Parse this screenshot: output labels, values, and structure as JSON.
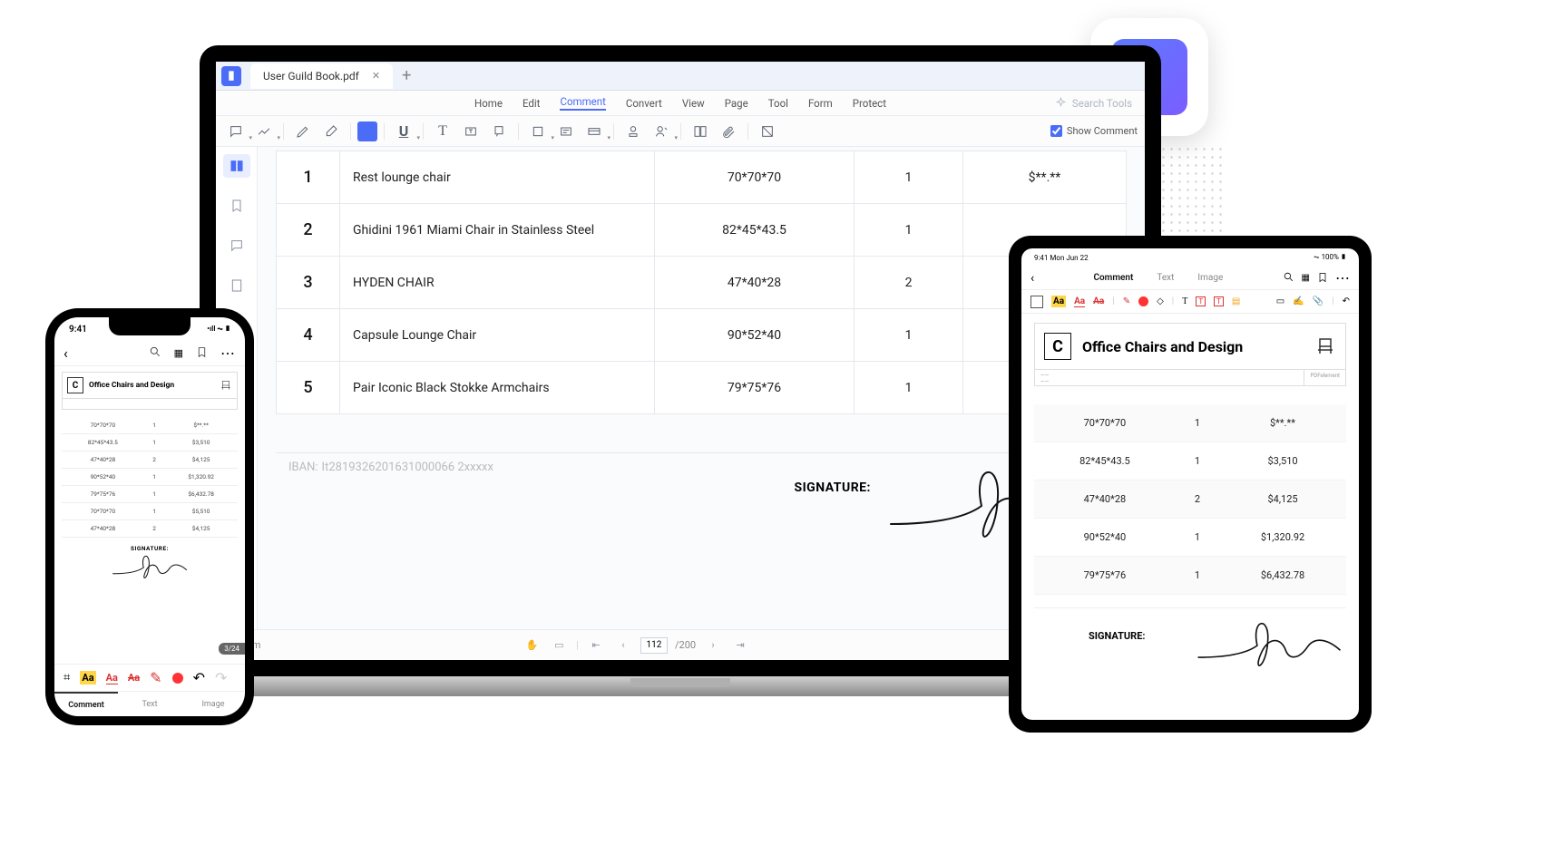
{
  "app_badge": {
    "name": "signature-app"
  },
  "laptop": {
    "tab_title": "User Guild Book.pdf",
    "menus": [
      "Home",
      "Edit",
      "Comment",
      "Convert",
      "View",
      "Page",
      "Tool",
      "Form",
      "Protect"
    ],
    "active_menu": "Comment",
    "search_placeholder": "Search Tools",
    "show_comment_label": "Show Comment",
    "show_comment_checked": true,
    "table_rows": [
      {
        "idx": "1",
        "name": "Rest lounge chair",
        "dims": "70*70*70",
        "qty": "1",
        "price": "$**.**"
      },
      {
        "idx": "2",
        "name": "Ghidini 1961 Miami Chair in Stainless Steel",
        "dims": "82*45*43.5",
        "qty": "1",
        "price": ""
      },
      {
        "idx": "3",
        "name": "HYDEN CHAIR",
        "dims": "47*40*28",
        "qty": "2",
        "price": ""
      },
      {
        "idx": "4",
        "name": "Capsule Lounge Chair",
        "dims": "90*52*40",
        "qty": "1",
        "price": ""
      },
      {
        "idx": "5",
        "name": "Pair Iconic Black Stokke Armchairs",
        "dims": "79*75*76",
        "qty": "1",
        "price": ""
      }
    ],
    "iban_label": "IBAN:",
    "iban_value": "It2819326201631000066 2xxxxx",
    "signature_label": "SIGNATURE:",
    "status": {
      "unit": "cm",
      "page": "112",
      "total": "/200"
    }
  },
  "phone": {
    "status_time": "9:41",
    "doc_title": "Office Chairs and Design",
    "rows": [
      {
        "dims": "70*70*70",
        "qty": "1",
        "price": "$**.**"
      },
      {
        "dims": "82*45*43.5",
        "qty": "1",
        "price": "$3,510"
      },
      {
        "dims": "47*40*28",
        "qty": "2",
        "price": "$4,125"
      },
      {
        "dims": "90*52*40",
        "qty": "1",
        "price": "$1,320.92"
      },
      {
        "dims": "79*75*76",
        "qty": "1",
        "price": "$6,432.78"
      },
      {
        "dims": "70*70*70",
        "qty": "1",
        "price": "$5,510"
      },
      {
        "dims": "47*40*28",
        "qty": "2",
        "price": "$4,125"
      }
    ],
    "signature_label": "SIGNATURE:",
    "page_badge": "3/24",
    "tabs": [
      "Comment",
      "Text",
      "Image"
    ],
    "active_tab": "Comment"
  },
  "tablet": {
    "status_left": "9:41  Mon Jun 22",
    "status_right": "100%",
    "top_tabs": [
      "Comment",
      "Text",
      "Image"
    ],
    "active_top_tab": "Comment",
    "doc_title": "Office Chairs and Design",
    "brand": "PDFelement",
    "rows": [
      {
        "dims": "70*70*70",
        "qty": "1",
        "price": "$**.**"
      },
      {
        "dims": "82*45*43.5",
        "qty": "1",
        "price": "$3,510"
      },
      {
        "dims": "47*40*28",
        "qty": "2",
        "price": "$4,125"
      },
      {
        "dims": "90*52*40",
        "qty": "1",
        "price": "$1,320.92"
      },
      {
        "dims": "79*75*76",
        "qty": "1",
        "price": "$6,432.78"
      }
    ],
    "signature_label": "SIGNATURE:"
  }
}
